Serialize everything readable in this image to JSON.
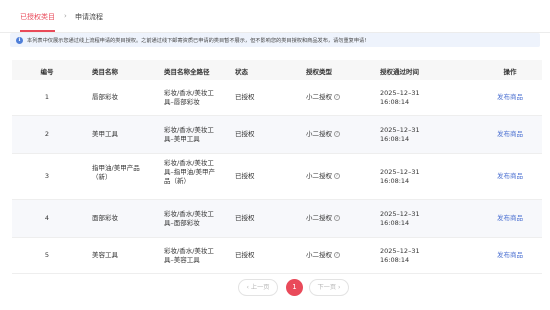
{
  "tabs": {
    "active": "已授权类目",
    "separator": "›",
    "other": "申请流程"
  },
  "notice": {
    "text": "本列表中仅展示您通过线上流程申请的类目授权。之前通过线下邮寄资质已申请的类目暂不展示，但不影响您的类目授权和商品发布，请勿重复申请!"
  },
  "table": {
    "headers": [
      "编号",
      "类目名称",
      "类目名称全路径",
      "状态",
      "授权类型",
      "授权通过时间",
      "操作"
    ],
    "rows": [
      {
        "no": "1",
        "name": "唇部彩妆",
        "path": "彩妆/香水/美妆工具–唇部彩妆",
        "status": "已授权",
        "type": "小二授权",
        "time": "2025–12–31 16:08:14",
        "action": "发布商品"
      },
      {
        "no": "2",
        "name": "美甲工具",
        "path": "彩妆/香水/美妆工具–美甲工具",
        "status": "已授权",
        "type": "小二授权",
        "time": "2025–12–31 16:08:14",
        "action": "发布商品"
      },
      {
        "no": "3",
        "name": "指甲油/美甲产品（新）",
        "path": "彩妆/香水/美妆工具–指甲油/美甲产品（新）",
        "status": "已授权",
        "type": "小二授权",
        "time": "2025–12–31 16:08:14",
        "action": "发布商品"
      },
      {
        "no": "4",
        "name": "面部彩妆",
        "path": "彩妆/香水/美妆工具–面部彩妆",
        "status": "已授权",
        "type": "小二授权",
        "time": "2025–12–31 16:08:14",
        "action": "发布商品"
      },
      {
        "no": "5",
        "name": "美容工具",
        "path": "彩妆/香水/美妆工具–美容工具",
        "status": "已授权",
        "type": "小二授权",
        "time": "2025–12–31 16:08:14",
        "action": "发布商品"
      }
    ]
  },
  "pagination": {
    "prev": "‹ 上一页",
    "current": "1",
    "next": "下一页 ›"
  }
}
